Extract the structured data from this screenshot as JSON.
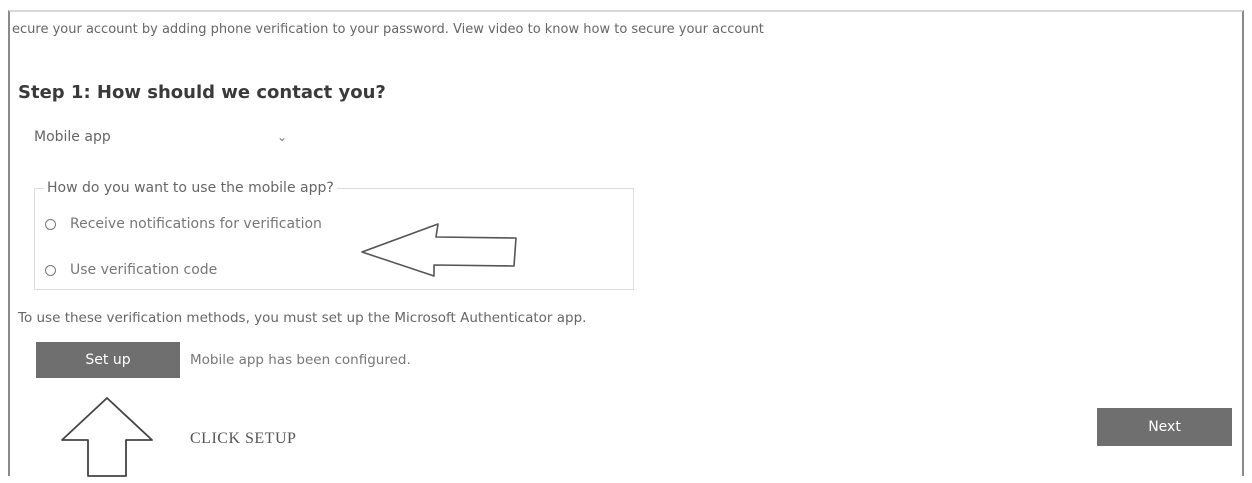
{
  "intro_text": "ecure your account by adding phone verification to your password. View video to know how to secure your account",
  "step_title": "Step 1: How should we contact you?",
  "contact_method": {
    "selected": "Mobile app",
    "icon": "chevron-down-icon"
  },
  "mobile_app_group": {
    "legend": "How do you want to use the mobile app?",
    "options": [
      {
        "label": "Receive notifications for verification",
        "selected": false
      },
      {
        "label": "Use verification code",
        "selected": false
      }
    ]
  },
  "setup_note": "To use these verification methods, you must set up the Microsoft Authenticator app.",
  "setup_button": "Set up",
  "setup_status": "Mobile app has been configured.",
  "annotation_text": "CLICK SETUP",
  "next_button": "Next",
  "colors": {
    "button_bg": "#6f6f6f",
    "button_text": "#ffffff",
    "text_gray": "#666666"
  }
}
